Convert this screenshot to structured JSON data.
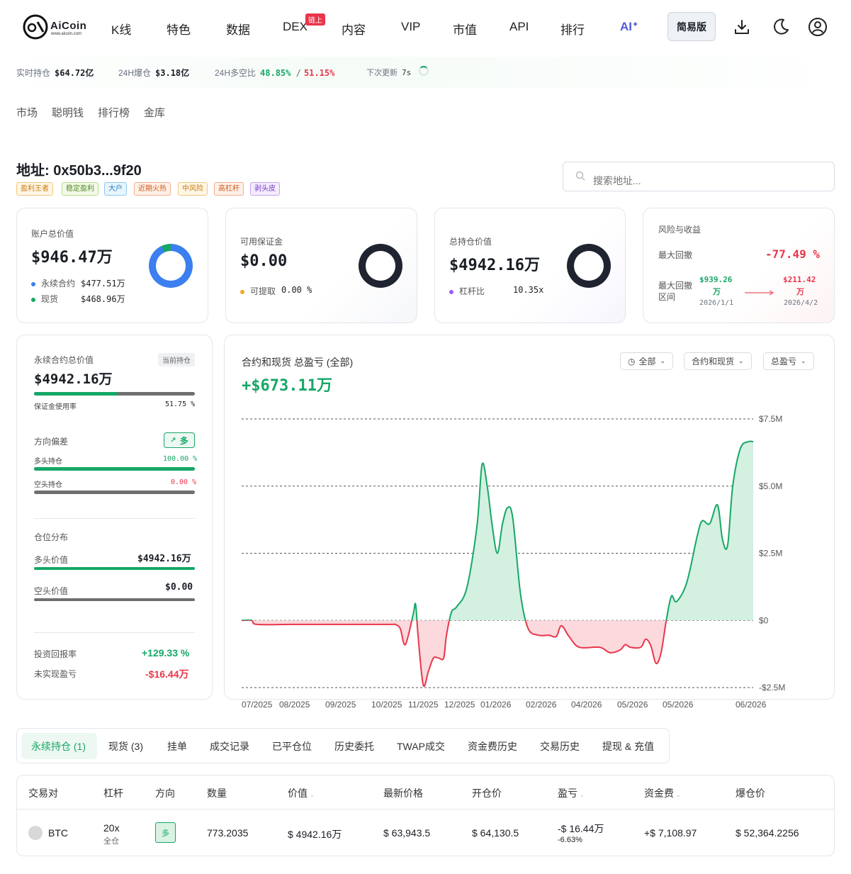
{
  "nav": {
    "logo_text": "AiCoin",
    "logo_sub": "www.aicoin.com",
    "items": [
      "K线",
      "特色",
      "数据",
      "DEX",
      "内容",
      "VIP",
      "市值",
      "API",
      "排行",
      "AI"
    ],
    "dex_badge": "链上",
    "simple_btn": "简易版"
  },
  "stats": {
    "oi_label": "实时持仓",
    "oi_value": "$64.72亿",
    "liq_label": "24H爆仓",
    "liq_value": "$3.18亿",
    "ls_label": "24H多空比",
    "long_pct": "48.85%",
    "sep": "/",
    "short_pct": "51.15%",
    "next_label": "下次更新",
    "next_value": "7s"
  },
  "subnav": [
    "市场",
    "聪明钱",
    "排行榜",
    "金库"
  ],
  "address": {
    "title": "地址: 0x50b3...9f20",
    "tags": [
      "盈利王者",
      "稳定盈利",
      "大户",
      "近期火热",
      "中风险",
      "高杠杆",
      "剥头皮"
    ],
    "search_placeholder": "搜索地址..."
  },
  "cards": {
    "total": {
      "label": "账户总价值",
      "value": "$946.47万",
      "perp_label": "永续合约",
      "perp_value": "$477.51万",
      "spot_label": "现货",
      "spot_value": "$468.96万"
    },
    "margin": {
      "label": "可用保证金",
      "value": "$0.00",
      "withdraw_label": "可提取",
      "withdraw_value": "0.00 %"
    },
    "position": {
      "label": "总持仓价值",
      "value": "$4942.16万",
      "lev_label": "杠杆比",
      "lev_value": "10.35x"
    },
    "risk": {
      "label": "风险与收益",
      "dd_label": "最大回撤",
      "dd_value": "-77.49 %",
      "range_label_1": "最大回撤",
      "range_label_2": "区间",
      "from_value_1": "$939.26",
      "from_value_2": "万",
      "from_date": "2026/1/1",
      "to_value_1": "$211.42",
      "to_value_2": "万",
      "to_date": "2026/4/2"
    }
  },
  "perp": {
    "title": "永续合约总价值",
    "badge": "当前持仓",
    "value": "$4942.16万",
    "margin_usage_label": "保证金使用率",
    "margin_usage_value": "51.75 %",
    "margin_usage_frac": 0.5175,
    "bias_label": "方向偏差",
    "bias_badge": "多",
    "long_label": "多头持仓",
    "long_pct": "100.00 %",
    "long_frac": 1.0,
    "short_label": "空头持仓",
    "short_pct": "0.00 %",
    "short_frac": 0.0,
    "dist_label": "仓位分布",
    "long_val_label": "多头价值",
    "long_val": "$4942.16万",
    "short_val_label": "空头价值",
    "short_val": "$0.00",
    "roi_label": "投资回报率",
    "roi_value": "+129.33 %",
    "upnl_label": "未实现盈亏",
    "upnl_value": "-$16.44万"
  },
  "chart_header": {
    "title": "合约和现货 总盈亏 (全部)",
    "total": "+$673.11万",
    "selectors": [
      "全部",
      "合约和现货",
      "总盈亏"
    ]
  },
  "chart_data": {
    "type": "area",
    "title": "合约和现货 总盈亏 (全部)",
    "ylim": [
      -2.5,
      7.5
    ],
    "yticks": [
      7.5,
      5.0,
      2.5,
      0,
      -2.5
    ],
    "ytick_labels": [
      "$7.5M",
      "$5.0M",
      "$2.5M",
      "$0",
      "-$2.5M"
    ],
    "xtick_labels": [
      "07/2025",
      "08/2025",
      "09/2025",
      "10/2025",
      "11/2025",
      "12/2025",
      "01/2026",
      "02/2026",
      "04/2026",
      "05/2026",
      "05/2026",
      "06/2026"
    ],
    "unit": "M USD",
    "series": [
      {
        "points": [
          [
            0,
            0
          ],
          [
            0.02,
            0
          ],
          [
            0.03,
            -0.15
          ],
          [
            0.1,
            -0.15
          ],
          [
            0.2,
            -0.15
          ],
          [
            0.29,
            -0.15
          ],
          [
            0.3,
            -0.15
          ],
          [
            0.31,
            -0.3
          ],
          [
            0.32,
            -0.9
          ],
          [
            0.335,
            0.2
          ],
          [
            0.34,
            0.6
          ],
          [
            0.345,
            -0.6
          ],
          [
            0.355,
            -2.4
          ],
          [
            0.365,
            -1.9
          ],
          [
            0.375,
            -1.4
          ],
          [
            0.385,
            -1.4
          ],
          [
            0.395,
            -1.4
          ],
          [
            0.4,
            -0.6
          ],
          [
            0.41,
            0.3
          ],
          [
            0.42,
            0.5
          ],
          [
            0.44,
            1.2
          ],
          [
            0.46,
            3.5
          ],
          [
            0.47,
            5.8
          ],
          [
            0.48,
            5.0
          ],
          [
            0.49,
            3.5
          ],
          [
            0.5,
            2.5
          ],
          [
            0.51,
            3.6
          ],
          [
            0.52,
            4.2
          ],
          [
            0.53,
            3.8
          ],
          [
            0.545,
            1.0
          ],
          [
            0.56,
            -0.3
          ],
          [
            0.58,
            -0.55
          ],
          [
            0.6,
            -0.55
          ],
          [
            0.615,
            -0.6
          ],
          [
            0.625,
            -0.2
          ],
          [
            0.64,
            -0.6
          ],
          [
            0.66,
            -1.0
          ],
          [
            0.7,
            -1.0
          ],
          [
            0.72,
            -1.2
          ],
          [
            0.74,
            -1.1
          ],
          [
            0.75,
            -0.9
          ],
          [
            0.76,
            -1.0
          ],
          [
            0.78,
            -1.0
          ],
          [
            0.79,
            -0.7
          ],
          [
            0.8,
            -0.95
          ],
          [
            0.81,
            -1.6
          ],
          [
            0.82,
            -1.2
          ],
          [
            0.83,
            0.0
          ],
          [
            0.84,
            0.9
          ],
          [
            0.85,
            0.7
          ],
          [
            0.87,
            1.4
          ],
          [
            0.89,
            3.1
          ],
          [
            0.9,
            3.7
          ],
          [
            0.915,
            3.6
          ],
          [
            0.93,
            4.3
          ],
          [
            0.94,
            3.0
          ],
          [
            0.95,
            2.8
          ],
          [
            0.96,
            5.0
          ],
          [
            0.975,
            6.4
          ],
          [
            0.99,
            6.65
          ],
          [
            1.0,
            6.65
          ]
        ]
      }
    ]
  },
  "tabs": [
    "永续持仓 (1)",
    "现货 (3)",
    "挂单",
    "成交记录",
    "已平仓位",
    "历史委托",
    "TWAP成交",
    "资金费历史",
    "交易历史",
    "提现 & 充值"
  ],
  "table": {
    "headers": [
      "交易对",
      "杠杆",
      "方向",
      "数量",
      "价值",
      "最新价格",
      "开仓价",
      "盈亏",
      "资金费",
      "爆仓价"
    ],
    "row": {
      "pair": "BTC",
      "lev": "20x",
      "lev_mode": "全仓",
      "side": "多",
      "qty": "773.2035",
      "value": "$ 4942.16万",
      "last": "$ 63,943.5",
      "entry": "$ 64,130.5",
      "pnl": "-$ 16.44万",
      "pnl_pct": "-6.63%",
      "funding": "+$ 7,108.97",
      "liq": "$ 52,364.2256"
    }
  }
}
